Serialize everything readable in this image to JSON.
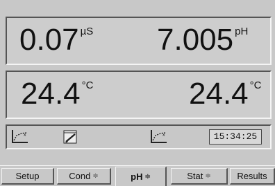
{
  "readings": {
    "conductivity": {
      "value": "0.07",
      "unit": "µS"
    },
    "ph": {
      "value": "7.005",
      "unit": "pH"
    },
    "temp_left": {
      "value": "24.4",
      "unit": "°C"
    },
    "temp_right": {
      "value": "24.4",
      "unit": "°C"
    }
  },
  "toolbar": {
    "icons": [
      "graph-icon",
      "notepad-icon",
      "graph-icon"
    ],
    "clock": "15:34:25"
  },
  "tabs": [
    {
      "label": "Setup",
      "arrows": ""
    },
    {
      "label": "Cond",
      "arrows": "≑"
    },
    {
      "label": "pH",
      "arrows": "≑"
    },
    {
      "label": "Stat",
      "arrows": "≑"
    },
    {
      "label": "Results",
      "arrows": ""
    }
  ],
  "active_tab": "pH"
}
